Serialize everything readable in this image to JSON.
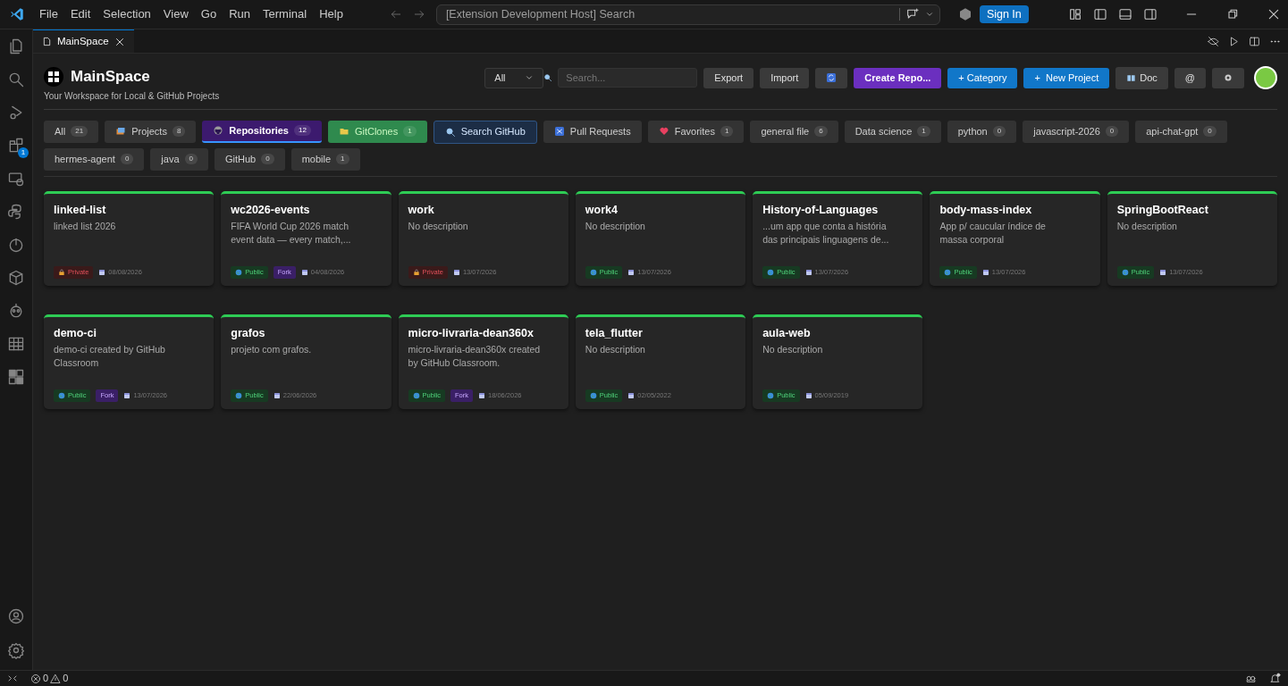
{
  "menu": [
    "File",
    "Edit",
    "Selection",
    "View",
    "Go",
    "Run",
    "Terminal",
    "Help"
  ],
  "command_center": {
    "placeholder": "[Extension Development Host] Search"
  },
  "sign_in": "Sign In",
  "activity_bar": {
    "extensions_badge": "1"
  },
  "editor_tab": {
    "title": "MainSpace"
  },
  "header": {
    "title": "MainSpace",
    "subtitle": "Your Workspace for Local & GitHub Projects",
    "filter": "All",
    "search": {
      "placeholder": "Search..."
    },
    "buttons": [
      {
        "kind": "dark",
        "label": "Export"
      },
      {
        "kind": "dark",
        "label": "Import"
      },
      {
        "kind": "sync"
      },
      {
        "kind": "purple",
        "label": "Create Repo..."
      },
      {
        "kind": "blue",
        "label": "+ Category"
      },
      {
        "kind": "blue",
        "label": "+  New Project"
      },
      {
        "kind": "doc",
        "label": "Doc"
      },
      {
        "kind": "dark",
        "label": "@"
      },
      {
        "kind": "gear"
      }
    ]
  },
  "categories": [
    {
      "kind": "plain",
      "label": "All",
      "count": "21",
      "selected": false
    },
    {
      "kind": "projects",
      "label": "Projects",
      "count": "8",
      "selected": false
    },
    {
      "kind": "repositories",
      "label": "Repositories",
      "count": "12",
      "selected": true
    },
    {
      "kind": "clones",
      "label": "GitClones",
      "count": "1",
      "selected": false
    },
    {
      "kind": "search",
      "label": "Search GitHub",
      "selected": false
    },
    {
      "kind": "pulls",
      "label": "Pull Requests",
      "selected": false
    },
    {
      "kind": "favorites",
      "label": "Favorites",
      "count": "1",
      "selected": false
    },
    {
      "kind": "plain",
      "label": "general file",
      "count": "6",
      "selected": false
    },
    {
      "kind": "plain",
      "label": "Data science",
      "count": "1",
      "selected": false
    },
    {
      "kind": "plain",
      "label": "python",
      "count": "0",
      "selected": false
    },
    {
      "kind": "plain",
      "label": "javascript-2026",
      "count": "0",
      "selected": false
    },
    {
      "kind": "plain",
      "label": "api-chat-gpt",
      "count": "0",
      "selected": false
    },
    {
      "kind": "plain",
      "label": "hermes-agent",
      "count": "0",
      "selected": false
    },
    {
      "kind": "plain",
      "label": "java",
      "count": "0",
      "selected": false
    },
    {
      "kind": "plain",
      "label": "GitHub",
      "count": "0",
      "selected": false
    },
    {
      "kind": "plain",
      "label": "mobile",
      "count": "1",
      "selected": false
    }
  ],
  "repos": [
    {
      "name": "linked-list",
      "description": "linked list 2026",
      "visibility": {
        "kind": "private",
        "label": "Private"
      },
      "date": "08/08/2026"
    },
    {
      "name": "wc2026-events",
      "description": "FIFA World Cup 2026 match event data — every match,...",
      "visibility": {
        "kind": "public",
        "label": "Public"
      },
      "fork": "Fork",
      "date": "04/08/2026"
    },
    {
      "name": "work",
      "description": "No description",
      "visibility": {
        "kind": "private",
        "label": "Private"
      },
      "date": "13/07/2026"
    },
    {
      "name": "work4",
      "description": "No description",
      "visibility": {
        "kind": "public",
        "label": "Public"
      },
      "date": "13/07/2026"
    },
    {
      "name": "History-of-Languages",
      "description": "...um app que conta a história das principais linguagens de...",
      "visibility": {
        "kind": "public",
        "label": "Public"
      },
      "date": "13/07/2026"
    },
    {
      "name": "body-mass-index",
      "description": "App p/ caucular índice de massa corporal",
      "visibility": {
        "kind": "public",
        "label": "Public"
      },
      "date": "13/07/2026"
    },
    {
      "name": "SpringBootReact",
      "description": "No description",
      "visibility": {
        "kind": "public",
        "label": "Public"
      },
      "date": "13/07/2026"
    },
    {
      "name": "demo-ci",
      "description": "demo-ci created by GitHub Classroom",
      "visibility": {
        "kind": "public",
        "label": "Public"
      },
      "fork": "Fork",
      "date": "13/07/2026"
    },
    {
      "name": "grafos",
      "description": "projeto com grafos.",
      "visibility": {
        "kind": "public",
        "label": "Public"
      },
      "date": "22/06/2026"
    },
    {
      "name": "micro-livraria-dean360x",
      "description": "micro-livraria-dean360x created by GitHub Classroom.",
      "visibility": {
        "kind": "public",
        "label": "Public"
      },
      "fork": "Fork",
      "date": "18/06/2026"
    },
    {
      "name": "tela_flutter",
      "description": "No description",
      "visibility": {
        "kind": "public",
        "label": "Public"
      },
      "date": "02/05/2022"
    },
    {
      "name": "aula-web",
      "description": "No description",
      "visibility": {
        "kind": "public",
        "label": "Public"
      },
      "date": "05/09/2019"
    }
  ],
  "status_bar": {
    "errors": "0",
    "warnings": "0"
  }
}
